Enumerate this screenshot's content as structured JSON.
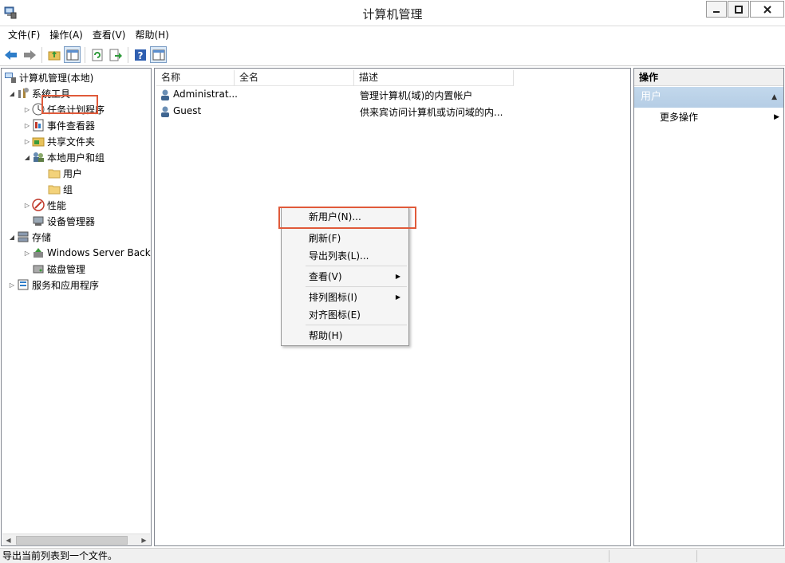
{
  "window": {
    "title": "计算机管理"
  },
  "menu": [
    "文件(F)",
    "操作(A)",
    "查看(V)",
    "帮助(H)"
  ],
  "toolbar": [
    "back-icon",
    "forward-icon",
    "up-folder-icon",
    "show-hide-tree-icon",
    "refresh-icon",
    "export-icon",
    "help-icon",
    "show-action-pane-icon"
  ],
  "tree": {
    "root": "计算机管理(本地)",
    "system_tools": "系统工具",
    "task_scheduler": "任务计划程序",
    "event_viewer": "事件查看器",
    "shared_folders": "共享文件夹",
    "local_users": "本地用户和组",
    "users": "用户",
    "groups": "组",
    "performance": "性能",
    "device_manager": "设备管理器",
    "storage": "存储",
    "backup": "Windows Server Back",
    "disk": "磁盘管理",
    "services": "服务和应用程序"
  },
  "list": {
    "columns": [
      "名称",
      "全名",
      "描述"
    ],
    "rows": [
      {
        "name": "Administrat...",
        "fullname": "",
        "desc": "管理计算机(域)的内置帐户"
      },
      {
        "name": "Guest",
        "fullname": "",
        "desc": "供来宾访问计算机或访问域的内..."
      }
    ]
  },
  "actions": {
    "header": "操作",
    "group": "用户",
    "more": "更多操作"
  },
  "context_menu": {
    "new_user": "新用户(N)...",
    "refresh": "刷新(F)",
    "export": "导出列表(L)...",
    "view": "查看(V)",
    "arrange": "排列图标(I)",
    "align": "对齐图标(E)",
    "help": "帮助(H)"
  },
  "status": "导出当前列表到一个文件。",
  "colors": {
    "highlight_box": "#e05a3a",
    "actions_group_bg": "#b9d1ea"
  }
}
